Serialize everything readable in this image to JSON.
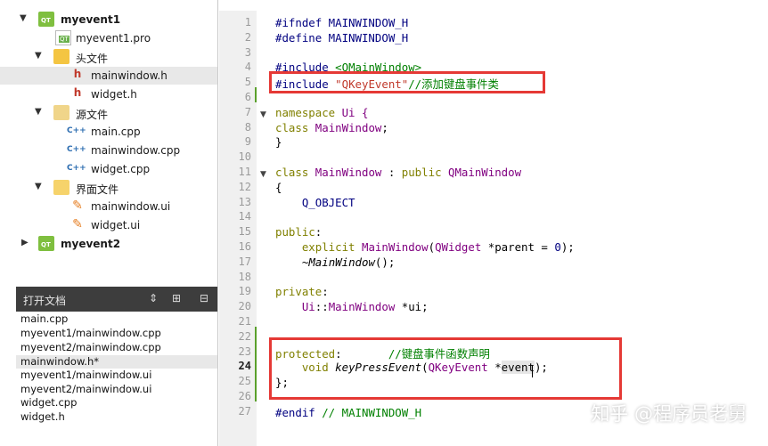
{
  "project_tree": [
    {
      "label": "myevent1",
      "icon": "qt-project-icon",
      "level": 0,
      "expanded": true,
      "bold": true
    },
    {
      "label": "myevent1.pro",
      "icon": "pro-file-icon",
      "level": 1
    },
    {
      "label": "头文件",
      "icon": "header-folder-icon",
      "level": 1,
      "expanded": true
    },
    {
      "label": "mainwindow.h",
      "icon": "header-file-icon",
      "level": 2,
      "selected": true
    },
    {
      "label": "widget.h",
      "icon": "header-file-icon",
      "level": 2
    },
    {
      "label": "源文件",
      "icon": "source-folder-icon",
      "level": 1,
      "expanded": true
    },
    {
      "label": "main.cpp",
      "icon": "cpp-file-icon",
      "level": 2
    },
    {
      "label": "mainwindow.cpp",
      "icon": "cpp-file-icon",
      "level": 2
    },
    {
      "label": "widget.cpp",
      "icon": "cpp-file-icon",
      "level": 2
    },
    {
      "label": "界面文件",
      "icon": "forms-folder-icon",
      "level": 1,
      "expanded": true
    },
    {
      "label": "mainwindow.ui",
      "icon": "ui-file-icon",
      "level": 2
    },
    {
      "label": "widget.ui",
      "icon": "ui-file-icon",
      "level": 2
    },
    {
      "label": "myevent2",
      "icon": "qt-project-icon",
      "level": 0,
      "expanded": false,
      "bold": true
    }
  ],
  "open_documents": {
    "title": "打开文档",
    "items": [
      "main.cpp",
      "myevent1/mainwindow.cpp",
      "myevent2/mainwindow.cpp",
      "mainwindow.h*",
      "myevent1/mainwindow.ui",
      "myevent2/mainwindow.ui",
      "widget.cpp",
      "widget.h"
    ],
    "selected_index": 3
  },
  "editor": {
    "current_line": 24,
    "lines": [
      {
        "n": "1"
      },
      {
        "n": "2"
      },
      {
        "n": "3"
      },
      {
        "n": "4"
      },
      {
        "n": "5"
      },
      {
        "n": "6"
      },
      {
        "n": "7"
      },
      {
        "n": "8"
      },
      {
        "n": "9"
      },
      {
        "n": "10"
      },
      {
        "n": "11"
      },
      {
        "n": "12"
      },
      {
        "n": "13"
      },
      {
        "n": "14"
      },
      {
        "n": "15"
      },
      {
        "n": "16"
      },
      {
        "n": "17"
      },
      {
        "n": "18"
      },
      {
        "n": "19"
      },
      {
        "n": "20"
      },
      {
        "n": "21"
      },
      {
        "n": "22"
      },
      {
        "n": "23"
      },
      {
        "n": "24"
      },
      {
        "n": "25"
      },
      {
        "n": "26"
      },
      {
        "n": "27"
      }
    ],
    "code": {
      "l1_a": "#ifndef",
      "l1_b": " MAINWINDOW_H",
      "l2_a": "#define",
      "l2_b": " MAINWINDOW_H",
      "l4_a": "#include",
      "l4_b": " <QMainWindow>",
      "l5_a": "#include",
      "l5_b": " \"QKeyEvent\"",
      "l5_c": "//添加键盘事件类",
      "l7_a": "namespace",
      "l7_b": " Ui {",
      "l8_a": "class",
      "l8_b": " MainWindow",
      ";": ";",
      "l9": "}",
      "l11_a": "class",
      "l11_b": " MainWindow",
      "l11_c": " : ",
      "l11_d": "public",
      "l11_e": " QMainWindow",
      "l12": "{",
      "l13": "    Q_OBJECT",
      "l15_a": "public",
      ":": ":",
      "l16_a": "    explicit",
      "l16_b": " MainWindow",
      "l16_c": "(",
      "l16_d": "QWidget",
      "l16_e": " *parent = ",
      "l16_f": "0",
      "l16_g": ");",
      "l17_a": "    ~",
      "l17_b": "MainWindow",
      "l17_c": "();",
      "l19_a": "private",
      "l20_a": "    Ui",
      "l20_b": "::",
      "l20_c": "MainWindow",
      "l20_d": " *ui;",
      "l23_a": "protected",
      ":2": ":",
      "l23_b": "       //键盘事件函数声明",
      "l24_a": "    void",
      "l24_b": " keyPressEvent",
      "l24_c": "(",
      "l24_d": "QKeyEvent",
      "l24_e": " *",
      "l24_f": "event",
      "l24_g": ");",
      "l25": "};",
      "l27_a": "#endif",
      "l27_b": " // MAINWINDOW_H"
    }
  },
  "watermark": "知乎 @程序员老舅",
  "colors": {
    "highlight_box": "#e53935",
    "header_bg": "#3d3d3d",
    "gutter_bg": "#f0f0f0"
  }
}
